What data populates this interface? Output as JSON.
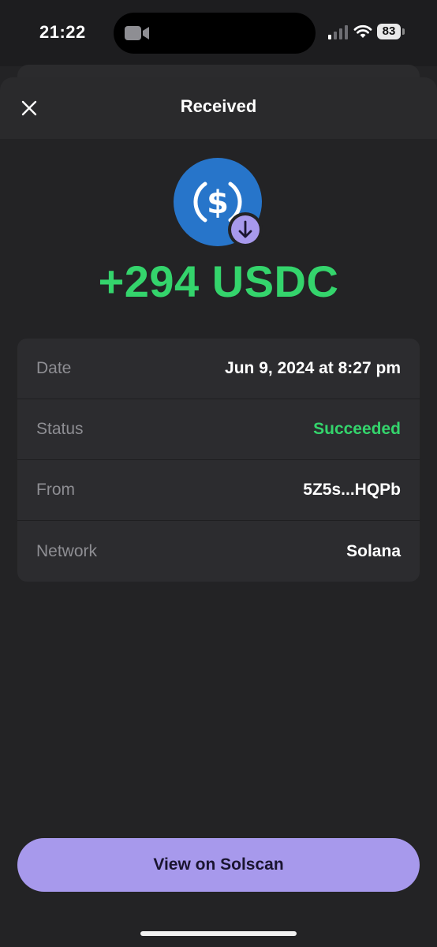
{
  "status_bar": {
    "time": "21:22",
    "battery": "83"
  },
  "sheet": {
    "title": "Received",
    "amount": "+294 USDC",
    "amount_color": "#34d46c"
  },
  "token": {
    "symbol_icon": "usdc-dollar-icon",
    "badge_icon": "arrow-down-icon",
    "brand_color": "#2775ca",
    "badge_color": "#a799ec"
  },
  "details": [
    {
      "label": "Date",
      "value": "Jun 9, 2024 at 8:27 pm"
    },
    {
      "label": "Status",
      "value": "Succeeded"
    },
    {
      "label": "From",
      "value": "5Z5s...HQPb"
    },
    {
      "label": "Network",
      "value": "Solana"
    }
  ],
  "status_color": "#34d46c",
  "actions": {
    "solscan_label": "View on Solscan",
    "button_color": "#a799ec"
  }
}
